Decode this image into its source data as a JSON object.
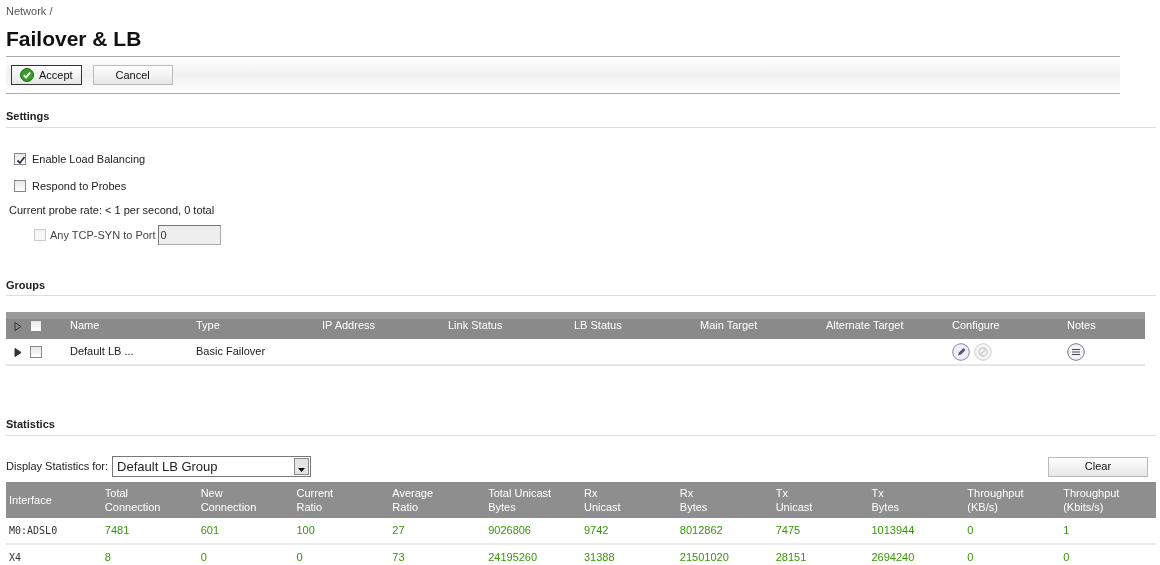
{
  "breadcrumb": "Network /",
  "title": "Failover & LB",
  "toolbar": [
    {
      "label": "Accept",
      "kind": "accept"
    },
    {
      "label": "Cancel",
      "kind": "plain"
    }
  ],
  "settings": {
    "heading": "Settings",
    "items": [
      {
        "kind": "checkbox",
        "label": "Enable Load Balancing",
        "checked": true
      },
      {
        "kind": "checkbox",
        "label": "Respond to Probes",
        "checked": false
      },
      {
        "kind": "text",
        "label": "Current probe rate: < 1 per second, 0 total"
      },
      {
        "kind": "port",
        "label": "Any TCP-SYN to Port",
        "checked": false,
        "disabled": true,
        "value": "0"
      }
    ]
  },
  "groups": {
    "heading": "Groups",
    "header_checked": false,
    "columns": [
      "Name",
      "Type",
      "IP Address",
      "Link Status",
      "LB Status",
      "Main Target",
      "Alternate Target",
      "Configure",
      "Notes"
    ],
    "rows": [
      {
        "name": "Default LB ...",
        "type": "Basic Failover",
        "checked": false
      }
    ]
  },
  "statistics": {
    "heading": "Statistics",
    "filter_label": "Display Statistics for:",
    "filter_value": "Default LB Group",
    "clear": "Clear",
    "columns": [
      "Interface",
      "Total\nConnection",
      "New\nConnection",
      "Current\nRatio",
      "Average\nRatio",
      "Total Unicast\nBytes",
      "Rx\nUnicast",
      "Rx\nBytes",
      "Tx\nUnicast",
      "Tx\nBytes",
      "Throughput\n(KB/s)",
      "Throughput\n(Kbits/s)"
    ],
    "rows": [
      [
        "M0:ADSL0",
        "7481",
        "601",
        "100",
        "27",
        "9026806",
        "9742",
        "8012862",
        "7475",
        "1013944",
        "0",
        "1"
      ],
      [
        "X4",
        "8",
        "0",
        "0",
        "73",
        "24195260",
        "31388",
        "21501020",
        "28151",
        "2694240",
        "0",
        "0"
      ]
    ]
  }
}
